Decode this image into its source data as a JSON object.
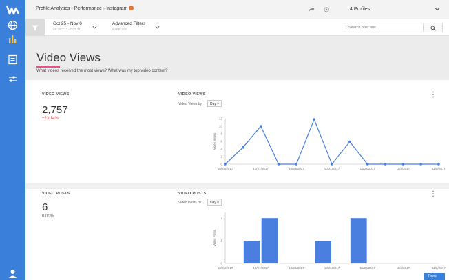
{
  "app": {
    "breadcrumb": [
      "Profile Analytics",
      "Performance",
      "Instagram"
    ],
    "breadcrumb_sep": "›",
    "profiles_selector": "4 Profiles"
  },
  "filters": {
    "date_range": "Oct 25 - Nov 6",
    "date_sub": "VS OCT 12 - OCT 24",
    "advanced_label": "Advanced Filters",
    "advanced_sub": "0 APPLIED",
    "search_placeholder": "Search post text..."
  },
  "page": {
    "title": "Video Views",
    "subtitle": "What videos received the most views? What was my top video content?"
  },
  "video_views": {
    "label": "VIDEO VIEWS",
    "value": "2,757",
    "delta": "+23.14%",
    "chart_title": "VIDEO VIEWS",
    "by_label": "Video Views by",
    "by_value": "Day"
  },
  "video_posts": {
    "label": "VIDEO POSTS",
    "value": "6",
    "delta": "0.00%",
    "chart_title": "VIDEO POSTS",
    "by_label": "Video Posts by",
    "by_value": "Day"
  },
  "done_button": "Done",
  "colors": {
    "rail": "#3a7fd9",
    "series": "#4a7fe0",
    "accent_underline": "#e8508c",
    "delta_positive": "#e04848",
    "instagram_dot": "#e8742c"
  },
  "icons": {
    "rail": [
      "logo-icon",
      "globe-icon",
      "bar-chart-icon",
      "report-icon",
      "sliders-icon",
      "user-icon"
    ],
    "top": [
      "share-icon",
      "gear-icon"
    ]
  },
  "chart_data": [
    {
      "type": "line",
      "title": "VIDEO VIEWS",
      "ylabel": "Video Views",
      "x": [
        "10/25/2017",
        "10/26/2017",
        "10/27/2017",
        "10/28/2017",
        "10/29/2017",
        "10/30/2017",
        "10/31/2017",
        "11/01/2017",
        "11/02/2017",
        "11/03/2017",
        "11/04/2017",
        "11/05/2017",
        "11/06/2017"
      ],
      "x_tick_labels": [
        "10/25/2017",
        "10/27/2017",
        "10/29/2017",
        "10/31/2017",
        "11/02/2017",
        "11/4/2017",
        "11/6/2017"
      ],
      "series": [
        {
          "values": [
            0,
            440,
            1000,
            0,
            0,
            1180,
            0,
            590,
            0,
            0,
            0,
            0,
            0
          ]
        }
      ],
      "y_ticks": [
        0,
        200,
        400,
        600,
        800,
        1000,
        1200
      ],
      "y_tick_labels": [
        "0",
        "2",
        "4",
        "6",
        "8",
        "10",
        "12"
      ],
      "ylim": [
        0,
        1200
      ],
      "grid": false
    },
    {
      "type": "bar",
      "title": "VIDEO POSTS",
      "ylabel": "Video Posts",
      "x": [
        "10/25/2017",
        "10/26/2017",
        "10/27/2017",
        "10/28/2017",
        "10/29/2017",
        "10/30/2017",
        "10/31/2017",
        "11/01/2017",
        "11/02/2017",
        "11/03/2017",
        "11/04/2017",
        "11/05/2017",
        "11/06/2017"
      ],
      "x_tick_labels": [
        "10/25/2017",
        "10/27/2017",
        "10/29/2017",
        "10/31/2017",
        "11/02/2017",
        "11/4/2017",
        "11/6/2017"
      ],
      "series": [
        {
          "values": [
            0,
            1,
            2,
            0,
            0,
            1,
            0,
            2,
            0,
            0,
            0,
            0,
            0
          ]
        }
      ],
      "y_ticks": [
        0,
        1,
        2,
        3
      ],
      "ylim": [
        0,
        2.25
      ],
      "grid": false
    }
  ]
}
